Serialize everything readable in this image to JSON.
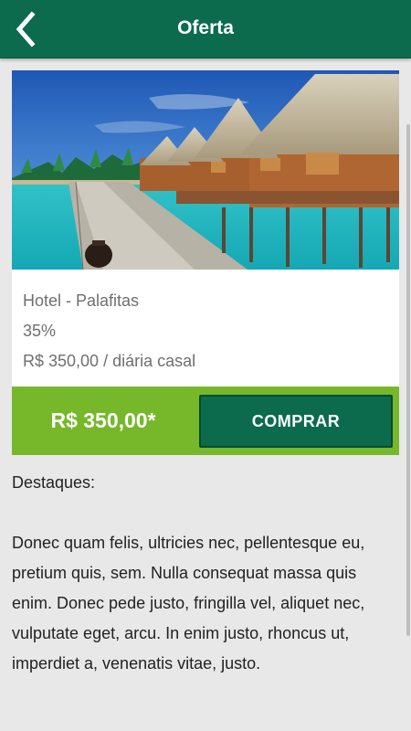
{
  "header": {
    "title": "Oferta",
    "back_icon": "chevron-left-icon",
    "background_color": "#0b6b4c"
  },
  "offer": {
    "image_alt": "Hotel - Palafitas",
    "name": "Hotel - Palafitas",
    "discount": "35%",
    "daily_rate": "R$ 350,00 / diária casal"
  },
  "purchase": {
    "price": "R$ 350,00*",
    "buy_label": "COMPRAR",
    "bar_color": "#76b82a",
    "button_color": "#0b6b4c"
  },
  "details": {
    "heading": "Destaques:",
    "text": "Donec quam felis, ultricies nec, pellentesque eu, pretium quis, sem. Nulla consequat massa quis enim. Donec pede justo, fringilla vel, aliquet nec, vulputate eget, arcu. In enim justo, rhoncus ut, imperdiet a, venenatis vitae, justo."
  }
}
